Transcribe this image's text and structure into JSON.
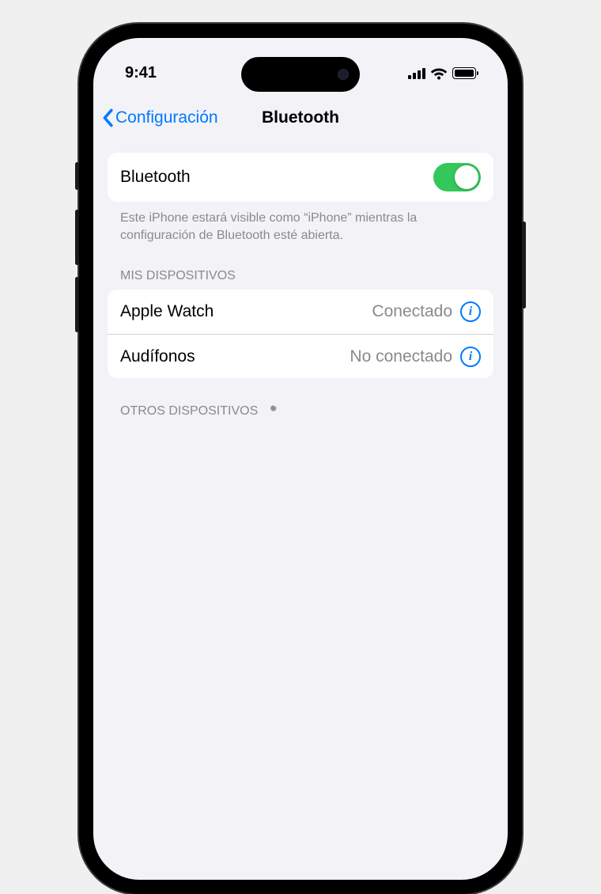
{
  "status": {
    "time": "9:41"
  },
  "nav": {
    "back_label": "Configuración",
    "title": "Bluetooth"
  },
  "bluetooth": {
    "label": "Bluetooth",
    "enabled": true,
    "footer": "Este iPhone estará visible como “iPhone” mientras la configuración de Bluetooth esté abierta."
  },
  "sections": {
    "my_devices_header": "MIS DISPOSITIVOS",
    "other_devices_header": "OTROS DISPOSITIVOS"
  },
  "devices": [
    {
      "name": "Apple Watch",
      "status": "Conectado"
    },
    {
      "name": "Audífonos",
      "status": "No conectado"
    }
  ],
  "colors": {
    "accent": "#007aff",
    "toggle_on": "#34c759",
    "bg": "#f2f2f7",
    "secondary_text": "#8a8a8e"
  }
}
